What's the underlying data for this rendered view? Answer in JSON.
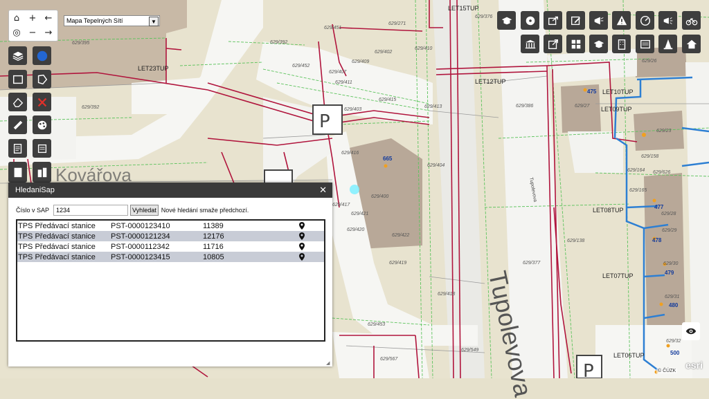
{
  "map": {
    "layer_select": "Mapa Tepelných Sítí",
    "street_label": "Tupolevova",
    "street_label_small": "Tupolevova",
    "street_label_left": "Kovářova",
    "attribution": "© ČÚZK",
    "esri": "esri",
    "place_labels": {
      "let15tup": "LET15TUP",
      "let23tup": "LET23TUP",
      "let12tup": "LET12TUP",
      "let10tup": "LET10TUP",
      "let09tup": "LET09TUP",
      "let08tup": "LET08TUP",
      "let07tup": "LET07TUP",
      "let06tup": "LET06TUP"
    },
    "parcel_labels": {
      "p1": "629/451",
      "p2": "629/395",
      "p3": "629/271",
      "p4": "629/376",
      "p5": "629/402",
      "p6": "629/409",
      "p7": "629/410",
      "p8": "629/392",
      "p9": "629/407",
      "p10": "629/411",
      "p11": "629/403",
      "p12": "629/415",
      "p13": "629/413",
      "p14": "629/386",
      "p15": "629/404",
      "p16": "629/400",
      "p17": "629/416",
      "p18": "629/417",
      "p19": "629/421",
      "p20": "629/422",
      "p21": "629/420",
      "p22": "629/419",
      "p23": "629/418",
      "p24": "629/138",
      "p25": "629/377",
      "p26": "629/453",
      "p27": "629/549",
      "p28": "629/567",
      "p29": "629/26",
      "p30": "629/27",
      "p31": "629/23",
      "p32": "629/158",
      "p33": "629/626",
      "p34": "629/164",
      "p35": "629/165",
      "p36": "629/28",
      "p37": "629/29",
      "p38": "629/30",
      "p39": "629/31",
      "p40": "629/32",
      "p41": "629/392",
      "p42": "629/452"
    },
    "address_numbers": {
      "n665": "665",
      "n475": "475",
      "n477": "477",
      "n478": "478",
      "n479": "479",
      "n480": "480",
      "n500": "500"
    }
  },
  "nav": {
    "home": "⌂",
    "zoom_in": "+",
    "zoom_out": "−",
    "back": "←",
    "forward": "→",
    "locate": "◎"
  },
  "dialog": {
    "title": "HledaniSap",
    "close": "✕",
    "sap_label": "Číslo v SAP",
    "sap_value": "1234",
    "search_button": "Vyhledat",
    "note": "Nové hledání smaže předchozí.",
    "results": [
      {
        "type": "TPS Předávací stanice",
        "code": "PST-0000123410",
        "number": "11389"
      },
      {
        "type": "TPS Předávací stanice",
        "code": "PST-0000121234",
        "number": "12176"
      },
      {
        "type": "TPS Předávací stanice",
        "code": "PST-0000112342",
        "number": "11716"
      },
      {
        "type": "TPS Předávací stanice",
        "code": "PST-0000123415",
        "number": "10805"
      }
    ]
  },
  "colors": {
    "toolbar_bg": "#3e3e3e",
    "dialog_title_bg": "#3a3a3a",
    "row_alt": "#c8ccd6",
    "pipe_red": "#b0143c",
    "pipe_blue": "#2d7fd3"
  },
  "icons": {
    "left_tools": [
      "layers-icon",
      "globe-icon",
      "rectangle-icon",
      "polygon-icon",
      "eraser-icon",
      "delete-icon",
      "ruler-icon",
      "palette-icon",
      "edit-doc-icon",
      "print-icon",
      "building-icon",
      "city-icon"
    ],
    "top_tools": [
      "graduation-icon",
      "film-icon",
      "export-icon",
      "edit-icon",
      "megaphone-icon",
      "warning-icon",
      "gauge-icon",
      "announce-icon",
      "bicycle-icon",
      "bank-icon",
      "open-external-icon",
      "grid-icon",
      "graduation2-icon",
      "building2-icon",
      "list-icon",
      "cone-icon",
      "home-icon"
    ]
  }
}
